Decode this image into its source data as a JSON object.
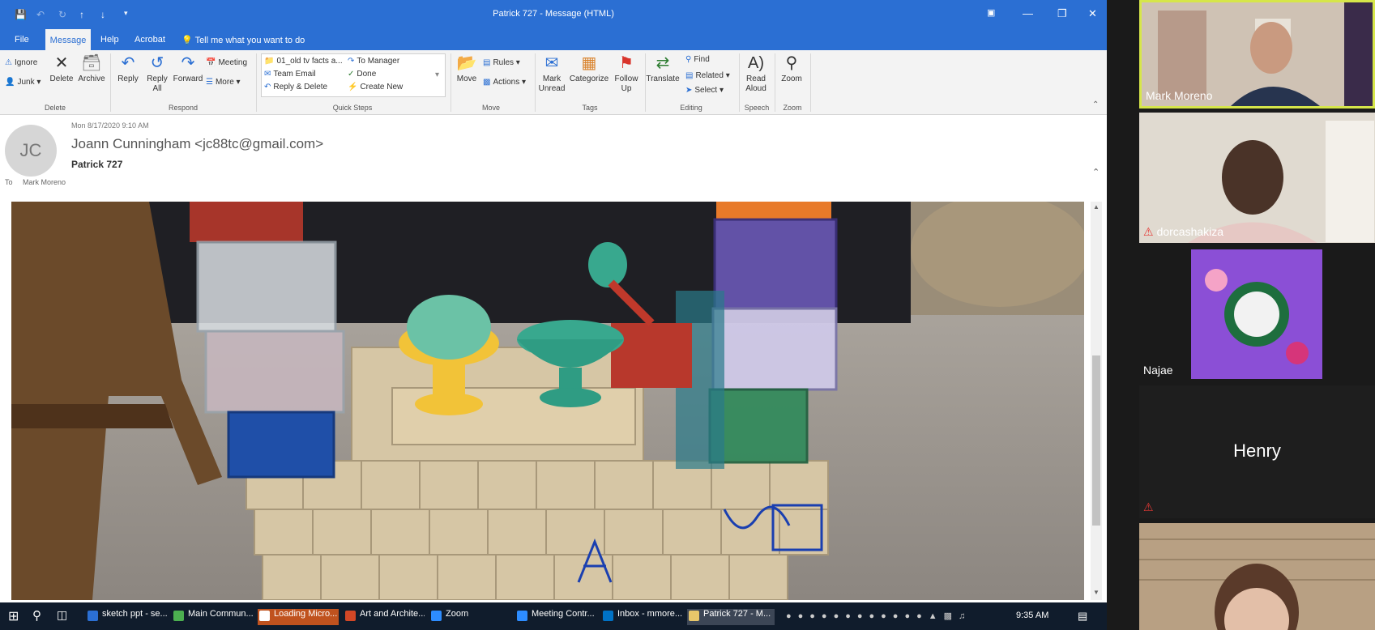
{
  "window": {
    "title": "Patrick 727  -  Message (HTML)"
  },
  "menu": {
    "tabs": [
      "File",
      "Message",
      "Help",
      "Acrobat"
    ],
    "tell_me": "Tell me what you want to do"
  },
  "ribbon": {
    "delete_group": {
      "label": "Delete",
      "ignore": "Ignore",
      "junk": "Junk",
      "delete": "Delete",
      "archive": "Archive"
    },
    "respond_group": {
      "label": "Respond",
      "reply": "Reply",
      "reply_all": "Reply All",
      "forward": "Forward",
      "meeting": "Meeting",
      "more": "More"
    },
    "quick_steps_group": {
      "label": "Quick Steps",
      "items": [
        "01_old tv facts a...",
        "To Manager",
        "Team Email",
        "Done",
        "Reply & Delete",
        "Create New"
      ]
    },
    "move_group": {
      "label": "Move",
      "move": "Move",
      "rules": "Rules",
      "actions": "Actions"
    },
    "tags_group": {
      "label": "Tags",
      "mark_unread": "Mark Unread",
      "categorize": "Categorize",
      "follow_up": "Follow Up"
    },
    "editing_group": {
      "label": "Editing",
      "translate": "Translate",
      "find": "Find",
      "related": "Related",
      "select": "Select"
    },
    "speech_group": {
      "label": "Speech",
      "read_aloud": "Read Aloud"
    },
    "zoom_group": {
      "label": "Zoom",
      "zoom": "Zoom"
    }
  },
  "message": {
    "avatar_initials": "JC",
    "date": "Mon 8/17/2020 9:10 AM",
    "sender": "Joann Cunningham <jc88tc@gmail.com>",
    "subject": "Patrick 727",
    "to_label": "To",
    "to_name": "Mark Moreno"
  },
  "taskbar": {
    "items": [
      {
        "label": "sketch ppt - se...",
        "color": "#2b6fd3"
      },
      {
        "label": "Main Commun...",
        "color": "#4caf50"
      },
      {
        "label": "Loading Micro...",
        "color": "#ffffff"
      },
      {
        "label": "Art and Archite...",
        "color": "#d24726"
      },
      {
        "label": "Zoom",
        "color": "#2d8cff"
      },
      {
        "label": "Meeting Contr...",
        "color": "#2d8cff"
      },
      {
        "label": "Inbox - mmore...",
        "color": "#0072c6"
      },
      {
        "label": "Patrick 727 - M...",
        "color": "#e8c76a"
      }
    ],
    "clock": "9:35 AM"
  },
  "zoom": {
    "participants": [
      {
        "name": "Mark Moreno",
        "muted": false,
        "active_speaker": true
      },
      {
        "name": "dorcashakiza",
        "muted": true
      },
      {
        "name": "Najae",
        "muted": false
      },
      {
        "name": "Henry",
        "muted": true,
        "video": false
      },
      {
        "name": "",
        "muted": false
      }
    ]
  },
  "colors": {
    "outlook_blue": "#2b6fd3",
    "active_speaker": "#d6e64a",
    "taskbar": "#101c2c"
  }
}
